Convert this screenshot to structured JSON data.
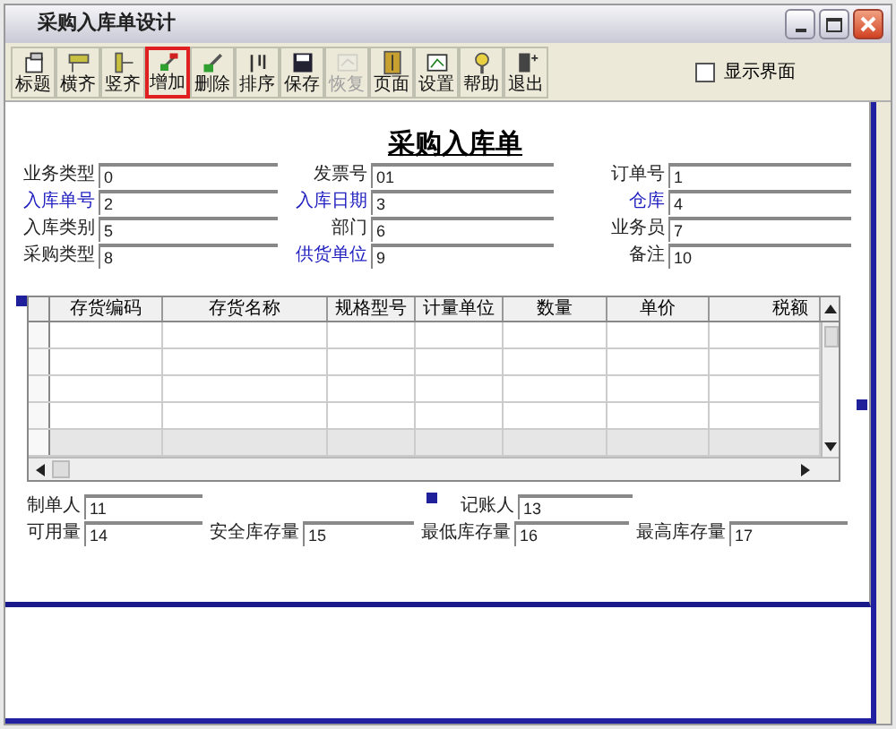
{
  "window": {
    "title": "采购入库单设计"
  },
  "toolbar": [
    {
      "label": "标题",
      "highlighted": false,
      "disabled": false
    },
    {
      "label": "横齐",
      "highlighted": false,
      "disabled": false
    },
    {
      "label": "竖齐",
      "highlighted": false,
      "disabled": false
    },
    {
      "label": "增加",
      "highlighted": true,
      "disabled": false
    },
    {
      "label": "删除",
      "highlighted": false,
      "disabled": false
    },
    {
      "label": "排序",
      "highlighted": false,
      "disabled": false
    },
    {
      "label": "保存",
      "highlighted": false,
      "disabled": false
    },
    {
      "label": "恢复",
      "highlighted": false,
      "disabled": true
    },
    {
      "label": "页面",
      "highlighted": false,
      "disabled": false
    },
    {
      "label": "设置",
      "highlighted": false,
      "disabled": false
    },
    {
      "label": "帮助",
      "highlighted": false,
      "disabled": false
    },
    {
      "label": "退出",
      "highlighted": false,
      "disabled": false
    }
  ],
  "show_ui_checkbox": {
    "label": "显示界面",
    "checked": false
  },
  "form": {
    "title": "采购入库单",
    "header_fields": [
      [
        {
          "label": "业务类型",
          "value": "0",
          "emphasized": false
        },
        {
          "label": "发票号",
          "value": "01",
          "emphasized": false
        },
        {
          "label": "订单号",
          "value": "1",
          "emphasized": false
        }
      ],
      [
        {
          "label": "入库单号",
          "value": "2",
          "emphasized": true
        },
        {
          "label": "入库日期",
          "value": "3",
          "emphasized": true
        },
        {
          "label": "仓库",
          "value": "4",
          "emphasized": true
        }
      ],
      [
        {
          "label": "入库类别",
          "value": "5",
          "emphasized": false
        },
        {
          "label": "部门",
          "value": "6",
          "emphasized": false
        },
        {
          "label": "业务员",
          "value": "7",
          "emphasized": false
        }
      ],
      [
        {
          "label": "采购类型",
          "value": "8",
          "emphasized": false
        },
        {
          "label": "供货单位",
          "value": "9",
          "emphasized": true
        },
        {
          "label": "备注",
          "value": "10",
          "emphasized": false
        }
      ]
    ],
    "table": {
      "columns": [
        "存货编码",
        "存货名称",
        "规格型号",
        "计量单位",
        "数量",
        "单价",
        "税额"
      ]
    },
    "footer_fields": [
      [
        {
          "label": "制单人",
          "value": "11"
        },
        {
          "label": "记账人",
          "value": "13"
        }
      ],
      [
        {
          "label": "可用量",
          "value": "14"
        },
        {
          "label": "安全库存量",
          "value": "15"
        },
        {
          "label": "最低库存量",
          "value": "16"
        },
        {
          "label": "最高库存量",
          "value": "17"
        }
      ]
    ]
  }
}
